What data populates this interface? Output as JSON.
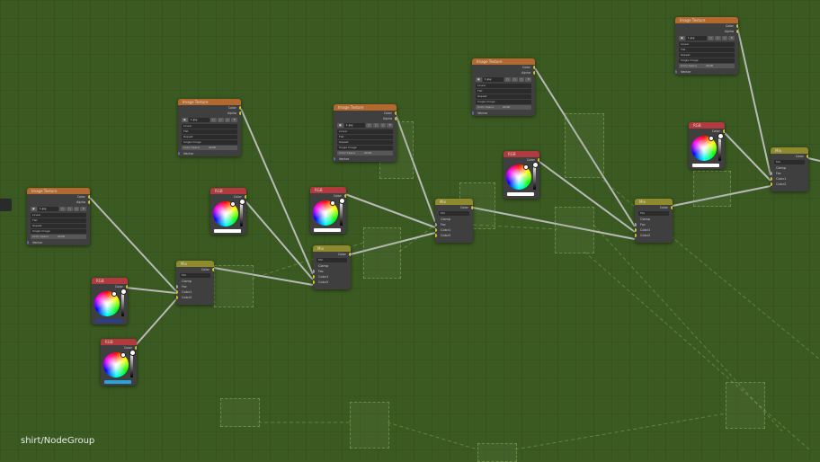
{
  "breadcrumb": "shirt/NodeGroup",
  "labels": {
    "color": "Color",
    "alpha": "Alpha",
    "fac": "Fac",
    "color1": "Color1",
    "color2": "Color2",
    "mix": "Mix",
    "clamp": "Clamp",
    "vector": "Vector"
  },
  "texture_settings": {
    "image": "1.jpg",
    "interpolation": "Linear",
    "projection": "Flat",
    "extension": "Repeat",
    "source": "Single Image",
    "color_space_label": "Color Space",
    "color_space": "sRGB"
  },
  "headers": {
    "image_texture": "Image Texture",
    "rgb": "RGB",
    "mix": "Mix"
  },
  "colors": {
    "background": "#3b5a22",
    "node_body": "#3f3f3f",
    "texture_header": "#b3692d",
    "rgb_header": "#b03a3e",
    "mix_header": "#8f8a2c",
    "link": "#b9b9b9",
    "socket_color": "#c7c729",
    "socket_float": "#a1a1a1",
    "socket_vector": "#6363c7"
  }
}
